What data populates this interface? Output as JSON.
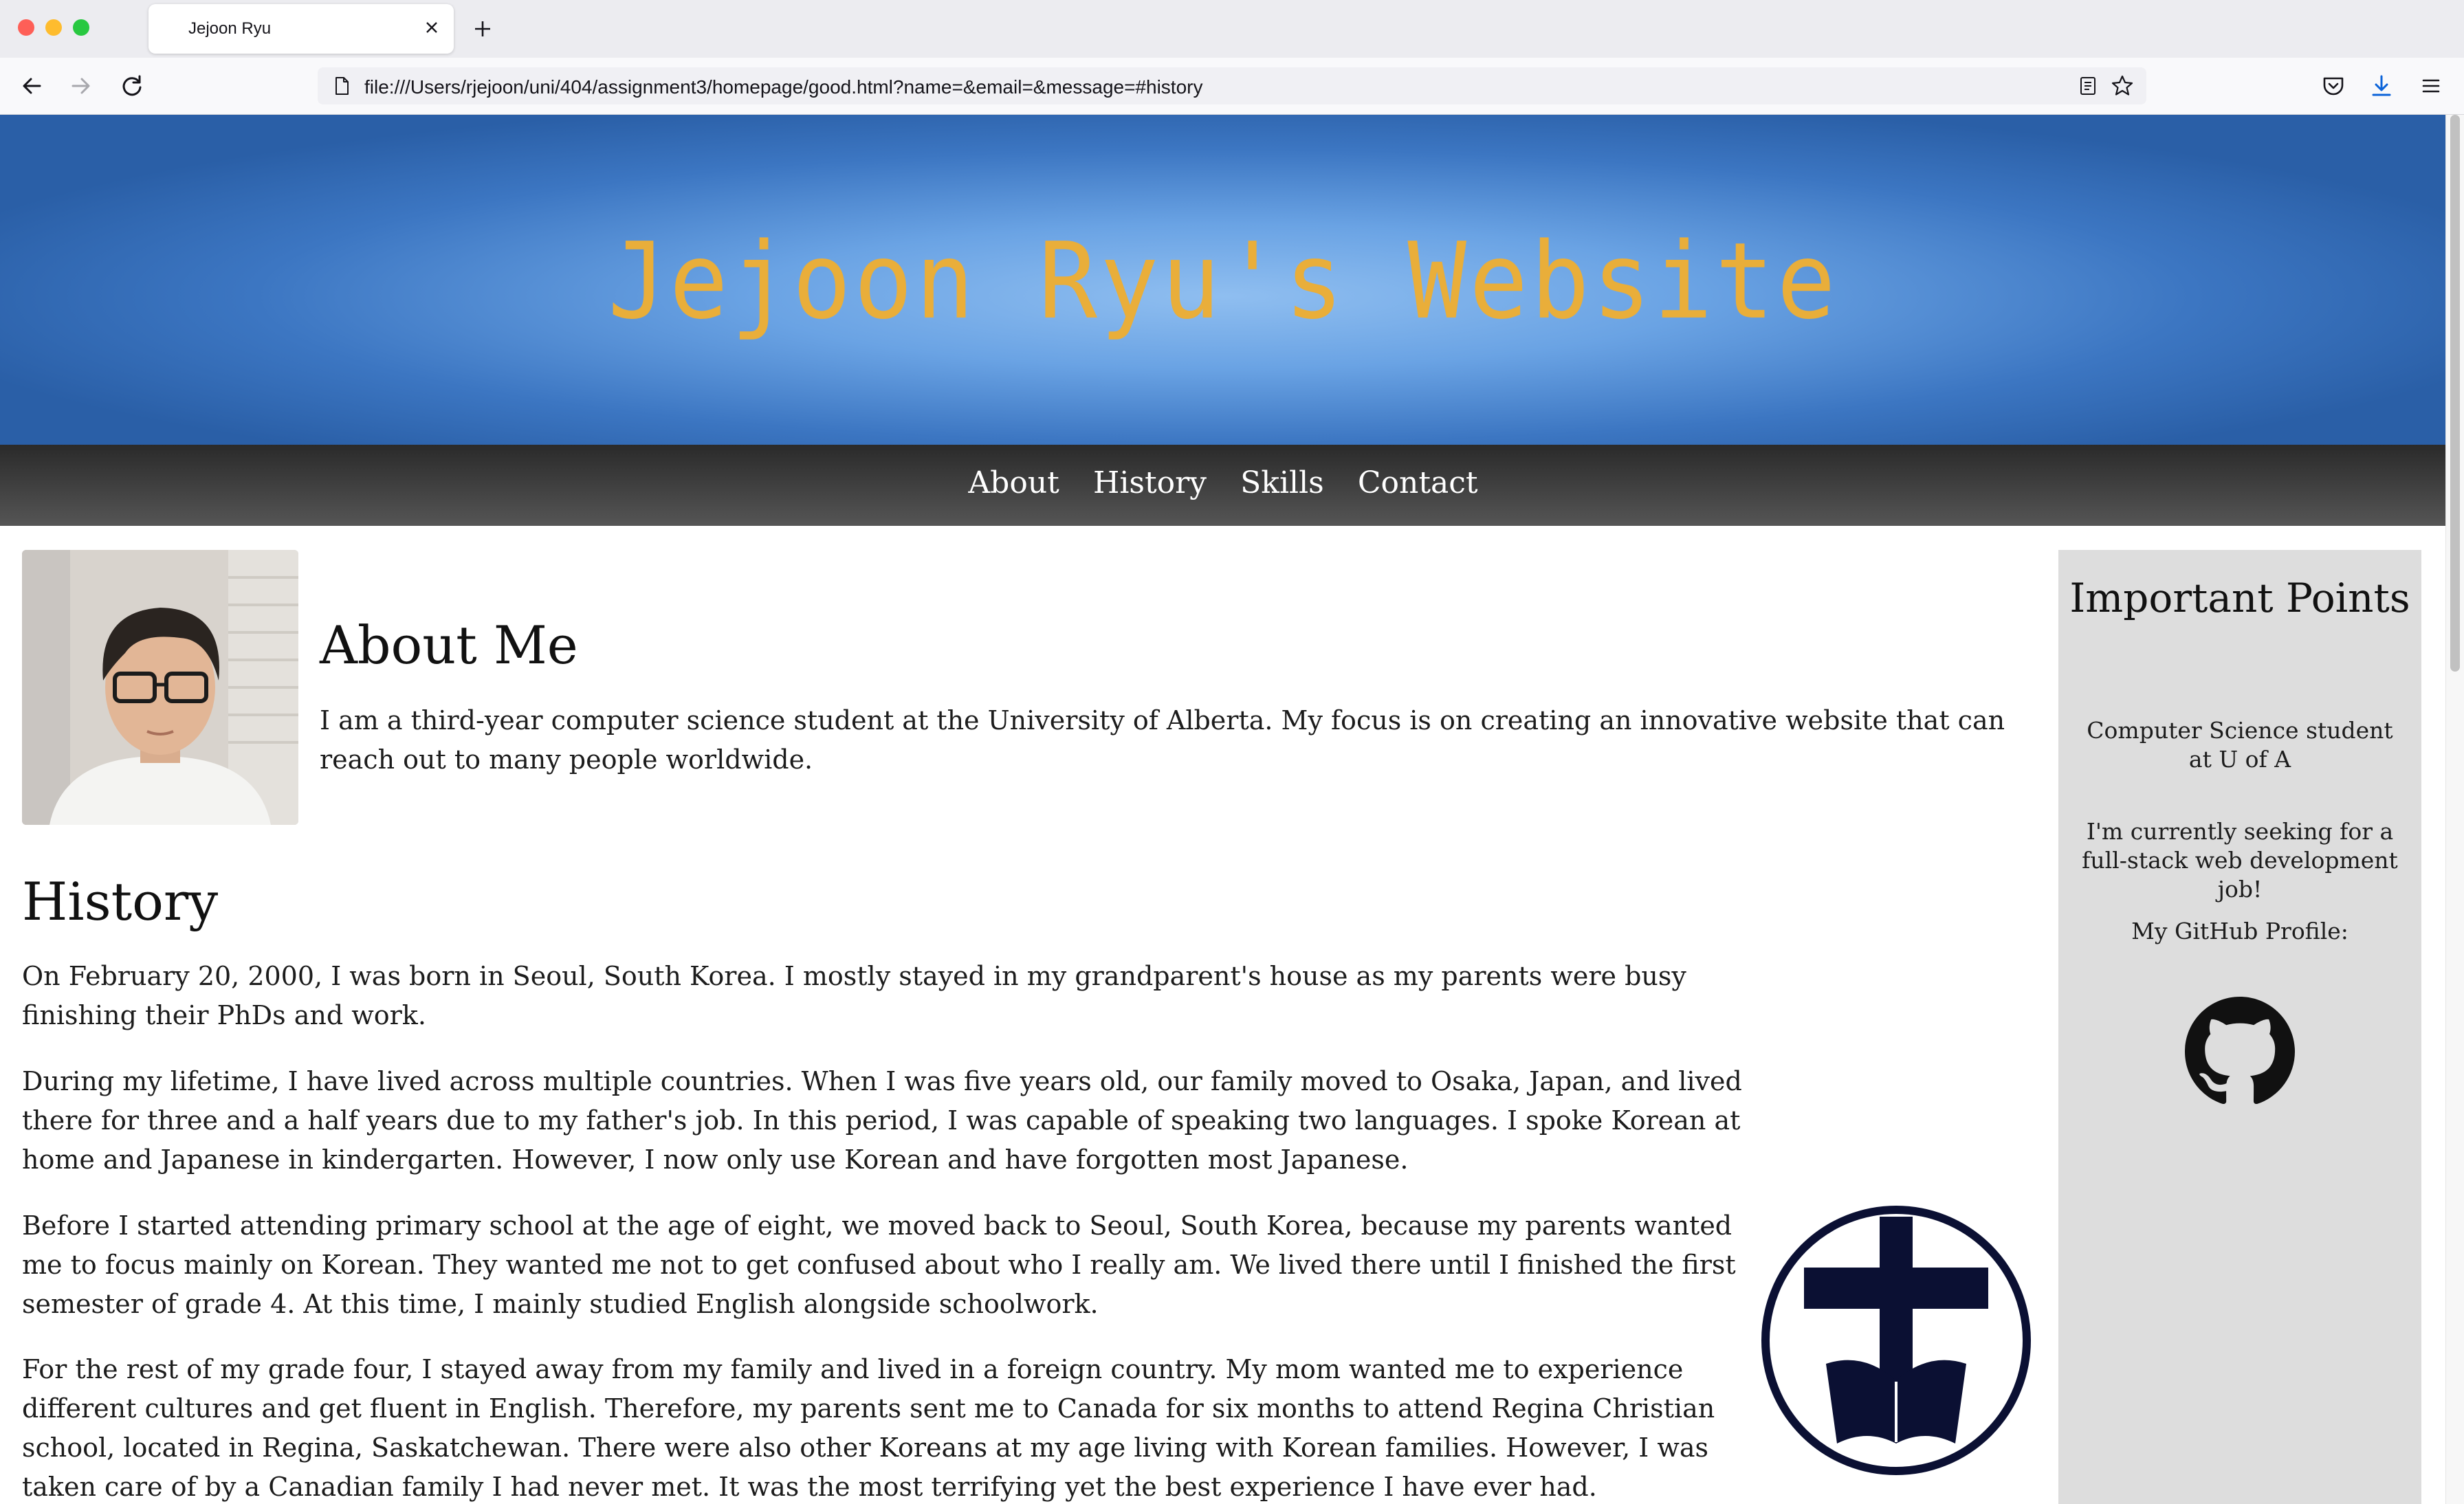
{
  "browser": {
    "tab_title": "Jejoon Ryu",
    "url": "file:///Users/rjejoon/uni/404/assignment3/homepage/good.html?name=&email=&message=#history"
  },
  "site": {
    "title": "Jejoon Ryu's Website",
    "nav": [
      "About",
      "History",
      "Skills",
      "Contact"
    ]
  },
  "about": {
    "heading": "About Me",
    "text": "I am a third-year computer science student at the University of Alberta. My focus is on creating an innovative website that can reach out to many people worldwide."
  },
  "history": {
    "heading": "History",
    "paragraphs": [
      "On February 20, 2000, I was born in Seoul, South Korea. I mostly stayed in my grandparent's house as my parents were busy finishing their PhDs and work.",
      "During my lifetime, I have lived across multiple countries. When I was five years old, our family moved to Osaka, Japan, and lived there for three and a half years due to my father's job. In this period, I was capable of speaking two languages. I spoke Korean at home and Japanese in kindergarten. However, I now only use Korean and have forgotten most Japanese.",
      "Before I started attending primary school at the age of eight, we moved back to Seoul, South Korea, because my parents wanted me to focus mainly on Korean. They wanted me not to get confused about who I really am. We lived there until I finished the first semester of grade 4. At this time, I mainly studied English alongside schoolwork.",
      "For the rest of my grade four, I stayed away from my family and lived in a foreign country. My mom wanted me to experience different cultures and get fluent in English. Therefore, my parents sent me to Canada for six months to attend Regina Christian school, located in Regina, Saskatchewan. There were also other Koreans at my age living with Korean families. However, I was taken care of by a Canadian family I had never met. It was the most terrifying yet the best experience I have ever had."
    ]
  },
  "sidebar": {
    "title": "Important Points",
    "points": [
      "Computer Science student at U of A",
      "I'm currently seeking for a full-stack web development job!",
      "My GitHub Profile:"
    ]
  },
  "colors": {
    "title_gold": "#e9ae3a",
    "header_blue": "#3c76c2",
    "logo_navy": "#0b1033",
    "sidebar_bg": "#dddddd"
  },
  "icons": [
    "page-icon",
    "reader-view-icon",
    "bookmark-star-icon",
    "pocket-icon",
    "download-icon",
    "hamburger-menu-icon",
    "back-arrow-icon",
    "forward-arrow-icon",
    "reload-icon",
    "github-icon"
  ]
}
